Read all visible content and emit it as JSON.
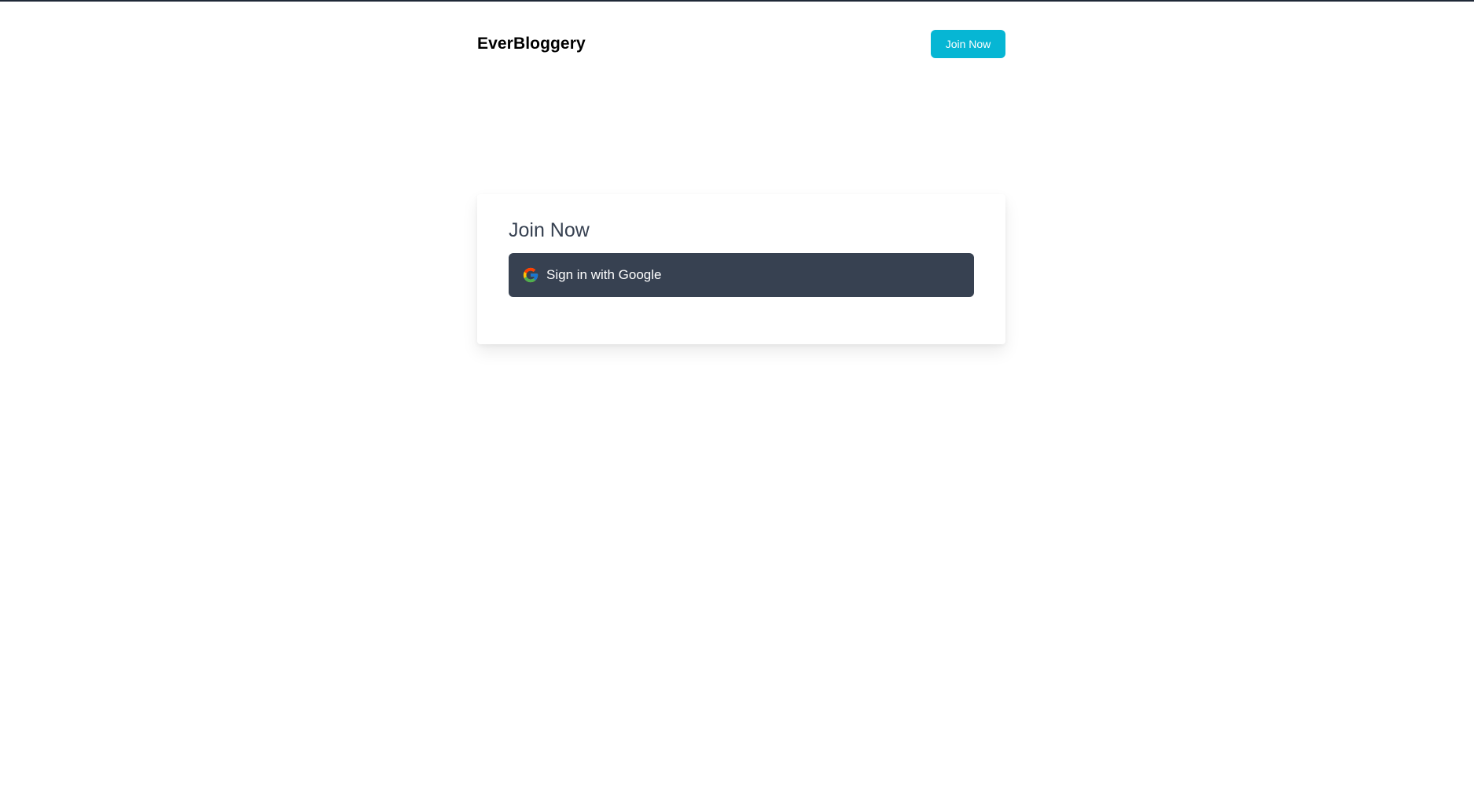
{
  "header": {
    "brand": "EverBloggery",
    "join_button_label": "Join Now"
  },
  "card": {
    "title": "Join Now",
    "google_button_label": "Sign in with Google",
    "google_icon": "google-g-icon"
  },
  "colors": {
    "accent": "#06b6d4",
    "button_dark": "#374151",
    "brand_text": "#000000",
    "top_rule": "#1f2937"
  }
}
